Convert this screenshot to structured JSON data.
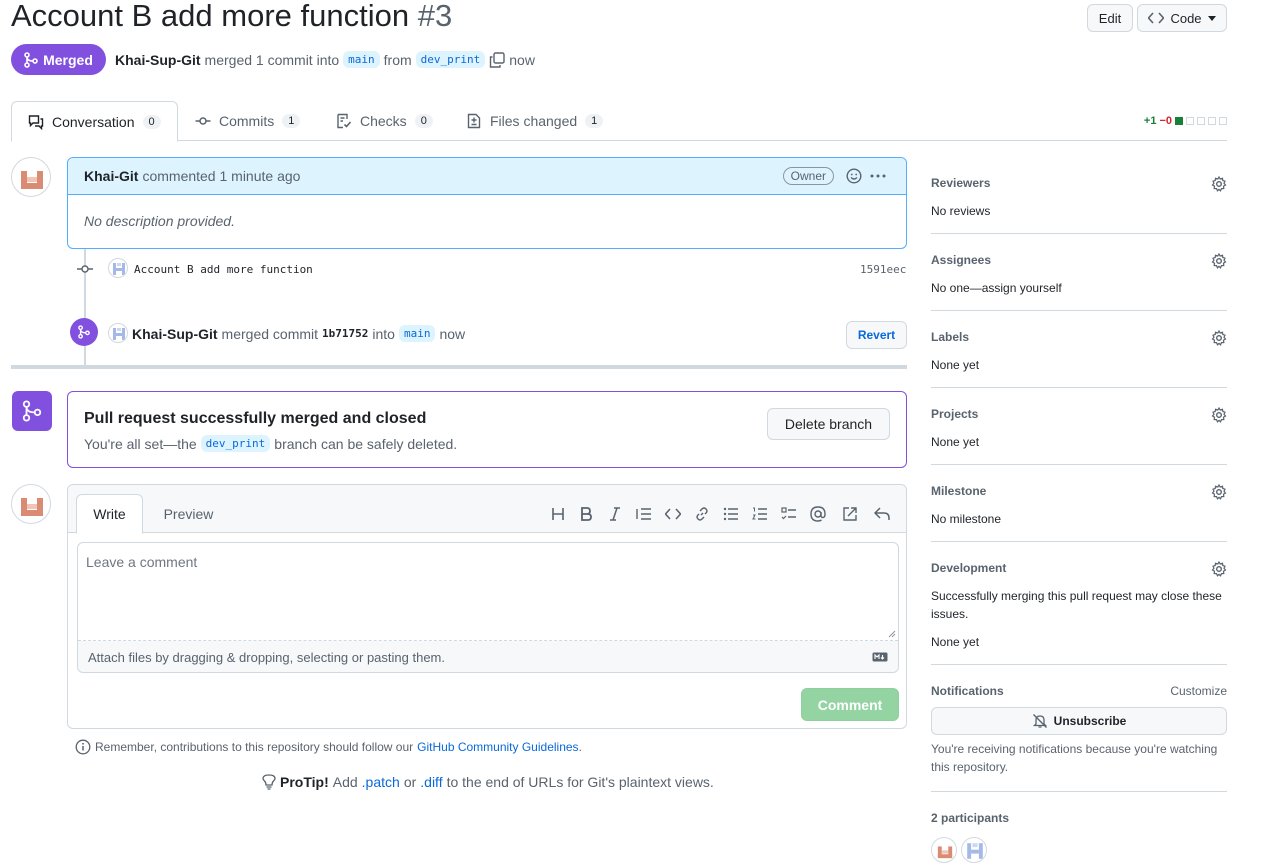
{
  "header": {
    "title": "Account B add more function",
    "number": "#3",
    "edit_label": "Edit",
    "code_label": "Code",
    "state": "Merged",
    "merger": "Khai-Sup-Git",
    "merged_text": "merged 1 commit into",
    "base_branch": "main",
    "from_text": "from",
    "head_branch": "dev_print",
    "time": "now"
  },
  "tabs": [
    {
      "label": "Conversation",
      "count": "0",
      "icon": "comment-discussion-icon"
    },
    {
      "label": "Commits",
      "count": "1",
      "icon": "git-commit-icon"
    },
    {
      "label": "Checks",
      "count": "0",
      "icon": "checklist-icon"
    },
    {
      "label": "Files changed",
      "count": "1",
      "icon": "file-diff-icon"
    }
  ],
  "diffstat": {
    "additions": "+1",
    "deletions": "−0",
    "blocks_green": 1,
    "blocks_total": 5
  },
  "comment": {
    "author": "Khai-Git",
    "action": "commented 1 minute ago",
    "badge": "Owner",
    "body": "No description provided."
  },
  "commit_event": {
    "message": "Account B add more function",
    "sha": "1591eec"
  },
  "merge_event": {
    "actor": "Khai-Sup-Git",
    "text1": "merged commit",
    "sha": "1b71752",
    "text2": "into",
    "branch": "main",
    "time": "now",
    "revert_label": "Revert"
  },
  "merged_box": {
    "title": "Pull request successfully merged and closed",
    "desc_prefix": "You're all set—the",
    "branch": "dev_print",
    "desc_suffix": "branch can be safely deleted.",
    "delete_label": "Delete branch"
  },
  "editor": {
    "tab_write": "Write",
    "tab_preview": "Preview",
    "placeholder": "Leave a comment",
    "attach_text": "Attach files by dragging & dropping, selecting or pasting them.",
    "submit_label": "Comment",
    "toolbar": [
      "heading-icon",
      "bold-icon",
      "italic-icon",
      "quote-icon",
      "code-icon",
      "link-icon",
      "unordered-list-icon",
      "ordered-list-icon",
      "task-list-icon",
      "mention-icon",
      "reference-icon",
      "reply-icon"
    ]
  },
  "footer": {
    "guidelines_prefix": "Remember, contributions to this repository should follow our",
    "guidelines_link": "GitHub Community Guidelines",
    "guidelines_suffix": ".",
    "protip_label": "ProTip!",
    "protip_text1": "Add",
    "protip_patch": ".patch",
    "protip_or": "or",
    "protip_diff": ".diff",
    "protip_text2": "to the end of URLs for Git's plaintext views."
  },
  "sidebar": {
    "reviewers": {
      "title": "Reviewers",
      "value": "No reviews"
    },
    "assignees": {
      "title": "Assignees",
      "value": "No one—assign yourself"
    },
    "labels": {
      "title": "Labels",
      "value": "None yet"
    },
    "projects": {
      "title": "Projects",
      "value": "None yet"
    },
    "milestone": {
      "title": "Milestone",
      "value": "No milestone"
    },
    "development": {
      "title": "Development",
      "desc": "Successfully merging this pull request may close these issues.",
      "value": "None yet"
    },
    "notifications": {
      "title": "Notifications",
      "customize": "Customize",
      "button": "Unsubscribe",
      "desc": "You're receiving notifications because you're watching this repository."
    },
    "participants": {
      "title": "2 participants"
    }
  },
  "colors": {
    "merged": "#8250df",
    "link": "#0969da",
    "comment_button": "#94d3a2"
  }
}
